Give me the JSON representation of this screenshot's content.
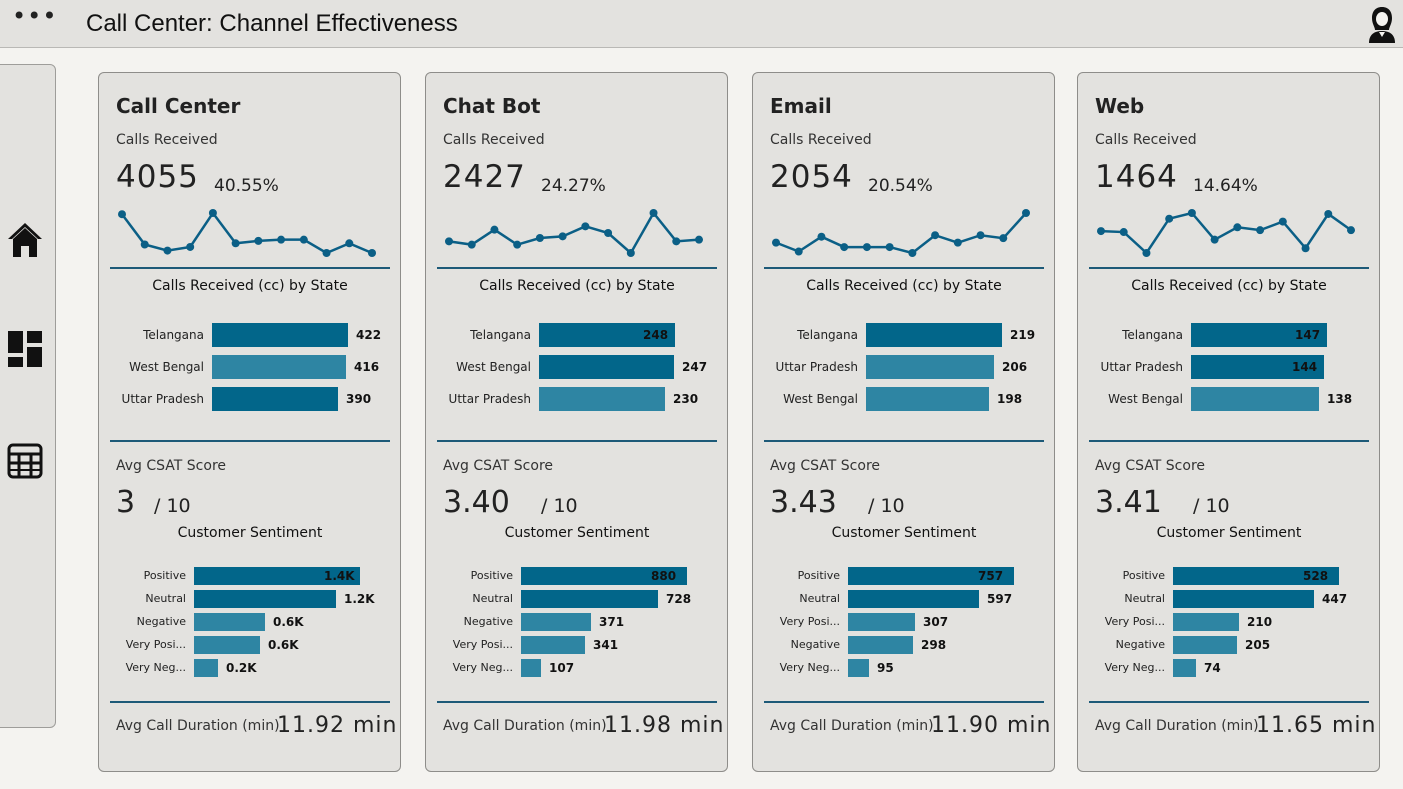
{
  "header": {
    "title": "Call Center: Channel Effectiveness",
    "menu_icon": "more-icon",
    "user_icon": "user-avatar-icon"
  },
  "sidebar": {
    "items": [
      {
        "name": "home",
        "icon": "home-icon"
      },
      {
        "name": "dashboard",
        "icon": "dashboard-icon"
      },
      {
        "name": "table",
        "icon": "table-icon"
      }
    ]
  },
  "colors": {
    "dark": "#02668a",
    "light": "#2e85a3",
    "line": "#0b5f86",
    "rule": "#1d5a78"
  },
  "cards": [
    {
      "title": "Call Center",
      "calls_label": "Calls Received",
      "calls_value": "4055",
      "calls_pct": "40.55%",
      "trend": [
        70,
        45,
        40,
        43,
        71,
        46,
        48,
        49,
        49,
        38,
        46,
        38
      ],
      "state_chart_title": "Calls Received (cc) by State",
      "states": [
        {
          "name": "Telangana",
          "value": 422,
          "label": "422",
          "shade": "dark"
        },
        {
          "name": "West Bengal",
          "value": 416,
          "label": "416",
          "shade": "light"
        },
        {
          "name": "Uttar Pradesh",
          "value": 390,
          "label": "390",
          "shade": "dark"
        }
      ],
      "csat_label": "Avg CSAT Score",
      "csat_value": "3",
      "csat_outof": "/ 10",
      "sentiment_title": "Customer Sentiment",
      "sentiments": [
        {
          "name": "Positive",
          "value": 1400,
          "label": "1.4K",
          "inside": true
        },
        {
          "name": "Neutral",
          "value": 1200,
          "label": "1.2K",
          "inside": false
        },
        {
          "name": "Negative",
          "value": 600,
          "label": "0.6K",
          "inside": false
        },
        {
          "name": "Very Posi...",
          "value": 560,
          "label": "0.6K",
          "inside": false
        },
        {
          "name": "Very Neg...",
          "value": 200,
          "label": "0.2K",
          "inside": false
        }
      ],
      "duration_label": "Avg Call Duration (min)",
      "duration_value": "11.92 min"
    },
    {
      "title": "Chat Bot",
      "calls_label": "Calls Received",
      "calls_value": "2427",
      "calls_pct": "24.27%",
      "trend": [
        48,
        46,
        55,
        46,
        50,
        51,
        57,
        53,
        41,
        65,
        48,
        49
      ],
      "state_chart_title": "Calls Received (cc) by State",
      "states": [
        {
          "name": "Telangana",
          "value": 248,
          "label": "248",
          "shade": "dark",
          "inside": true
        },
        {
          "name": "West Bengal",
          "value": 247,
          "label": "247",
          "shade": "dark"
        },
        {
          "name": "Uttar Pradesh",
          "value": 230,
          "label": "230",
          "shade": "light"
        }
      ],
      "csat_label": "Avg CSAT Score",
      "csat_value": "3.40",
      "csat_outof": "/ 10",
      "sentiment_title": "Customer Sentiment",
      "sentiments": [
        {
          "name": "Positive",
          "value": 880,
          "label": "880",
          "inside": true
        },
        {
          "name": "Neutral",
          "value": 728,
          "label": "728",
          "inside": false
        },
        {
          "name": "Negative",
          "value": 371,
          "label": "371",
          "inside": false
        },
        {
          "name": "Very Posi...",
          "value": 341,
          "label": "341",
          "inside": false
        },
        {
          "name": "Very Neg...",
          "value": 107,
          "label": "107",
          "inside": false
        }
      ],
      "duration_label": "Avg Call Duration (min)",
      "duration_value": "11.98 min"
    },
    {
      "title": "Email",
      "calls_label": "Calls Received",
      "calls_value": "2054",
      "calls_pct": "20.54%",
      "trend": [
        53,
        47,
        57,
        50,
        50,
        50,
        46,
        58,
        53,
        58,
        56,
        73
      ],
      "state_chart_title": "Calls Received (cc) by State",
      "states": [
        {
          "name": "Telangana",
          "value": 219,
          "label": "219",
          "shade": "dark"
        },
        {
          "name": "Uttar Pradesh",
          "value": 206,
          "label": "206",
          "shade": "light"
        },
        {
          "name": "West Bengal",
          "value": 198,
          "label": "198",
          "shade": "light"
        }
      ],
      "csat_label": "Avg CSAT Score",
      "csat_value": "3.43",
      "csat_outof": "/ 10",
      "sentiment_title": "Customer Sentiment",
      "sentiments": [
        {
          "name": "Positive",
          "value": 757,
          "label": "757",
          "inside": true
        },
        {
          "name": "Neutral",
          "value": 597,
          "label": "597",
          "inside": false
        },
        {
          "name": "Very Posi...",
          "value": 307,
          "label": "307",
          "inside": false
        },
        {
          "name": "Negative",
          "value": 298,
          "label": "298",
          "inside": false
        },
        {
          "name": "Very Neg...",
          "value": 95,
          "label": "95",
          "inside": false
        }
      ],
      "duration_label": "Avg Call Duration (min)",
      "duration_value": "11.90 min"
    },
    {
      "title": "Web",
      "calls_label": "Calls Received",
      "calls_value": "1464",
      "calls_pct": "14.64%",
      "trend": [
        122,
        121,
        99,
        135,
        141,
        113,
        126,
        123,
        132,
        104,
        140,
        123
      ],
      "state_chart_title": "Calls Received (cc) by State",
      "states": [
        {
          "name": "Telangana",
          "value": 147,
          "label": "147",
          "shade": "dark",
          "inside": true
        },
        {
          "name": "Uttar Pradesh",
          "value": 144,
          "label": "144",
          "shade": "dark",
          "inside": true
        },
        {
          "name": "West Bengal",
          "value": 138,
          "label": "138",
          "shade": "light"
        }
      ],
      "csat_label": "Avg CSAT Score",
      "csat_value": "3.41",
      "csat_outof": "/ 10",
      "sentiment_title": "Customer Sentiment",
      "sentiments": [
        {
          "name": "Positive",
          "value": 528,
          "label": "528",
          "inside": true
        },
        {
          "name": "Neutral",
          "value": 447,
          "label": "447",
          "inside": false
        },
        {
          "name": "Very Posi...",
          "value": 210,
          "label": "210",
          "inside": false
        },
        {
          "name": "Negative",
          "value": 205,
          "label": "205",
          "inside": false
        },
        {
          "name": "Very Neg...",
          "value": 74,
          "label": "74",
          "inside": false
        }
      ],
      "duration_label": "Avg Call Duration (min)",
      "duration_value": "11.65 min"
    }
  ]
}
